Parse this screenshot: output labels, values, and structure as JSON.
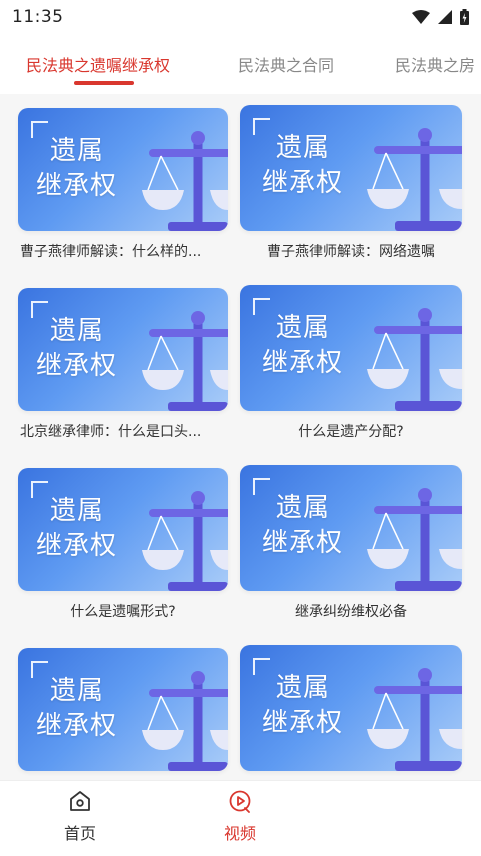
{
  "status": {
    "time": "11:35"
  },
  "tabs": [
    {
      "label": "民法典之遗嘱继承权",
      "active": true
    },
    {
      "label": "民法典之合同",
      "active": false
    },
    {
      "label": "民法典之房",
      "active": false
    }
  ],
  "thumb": {
    "line1": "遗属",
    "line2": "继承权"
  },
  "cards": [
    {
      "title": "曹子燕律师解读：什么样的..."
    },
    {
      "title": "曹子燕律师解读：网络遗嘱"
    },
    {
      "title": "北京继承律师：什么是口头..."
    },
    {
      "title": "什么是遗产分配?"
    },
    {
      "title": "什么是遗嘱形式?"
    },
    {
      "title": "继承纠纷维权必备"
    },
    {
      "title": ""
    },
    {
      "title": ""
    }
  ],
  "nav": [
    {
      "label": "首页",
      "icon": "home-icon",
      "active": false
    },
    {
      "label": "视频",
      "icon": "video-play-icon",
      "active": true
    }
  ],
  "colors": {
    "accent": "#d9372e",
    "thumb_blue": "#4a86ea"
  }
}
